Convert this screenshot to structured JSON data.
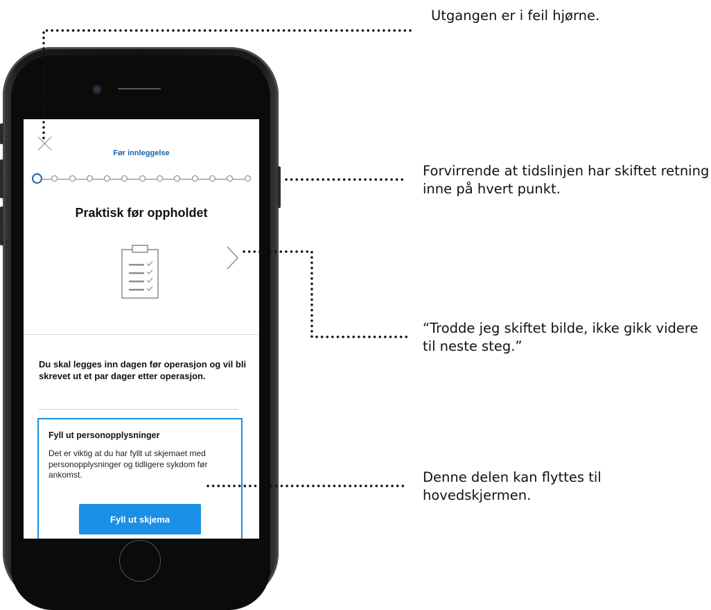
{
  "screen": {
    "step_title": "Før innleggelse",
    "timeline": {
      "total_steps": 13,
      "current_step": 1
    },
    "page_title": "Praktisk før oppholdet",
    "icons": {
      "close": "close-icon",
      "illustration": "clipboard-checklist-icon",
      "next": "chevron-right-icon"
    },
    "intro_text": "Du skal legges inn dagen før operasjon og vil bli skrevet ut et par dager etter operasjon.",
    "card": {
      "title": "Fyll ut personopplysninger",
      "text": "Det er viktig at du har fyllt ut skjemaet med personopplysninger og tidligere sykdom før ankomst.",
      "button_label": "Fyll ut skjema"
    },
    "colors": {
      "accent": "#1a8fe6",
      "title_blue": "#1b5fa8"
    }
  },
  "annotations": [
    {
      "text": "Utgangen er i feil hjørne."
    },
    {
      "text": "Forvirrende at tidslinjen har skiftet retning inne på hvert punkt."
    },
    {
      "text": "“Trodde jeg skiftet bilde, ikke gikk videre til neste steg.”"
    },
    {
      "text": "Denne delen kan flyttes til hovedskjermen."
    }
  ]
}
